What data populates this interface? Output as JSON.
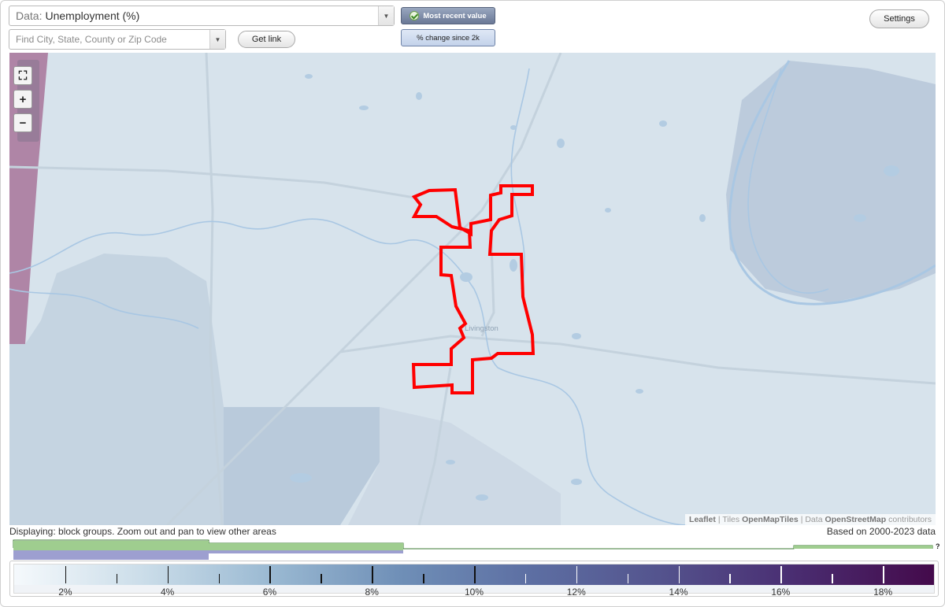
{
  "controls": {
    "data_label": "Data:",
    "data_value": "Unemployment (%)",
    "search_placeholder": "Find City, State, County or Zip Code",
    "get_link": "Get link",
    "most_recent": "Most recent value",
    "pct_change": "% change since 2k",
    "settings": "Settings"
  },
  "map": {
    "town_label": "Livingston",
    "attribution": {
      "leaflet": "Leaflet",
      "tiles_prefix": "| Tiles",
      "tiles": "OpenMapTiles",
      "data_prefix": "| Data",
      "data": "OpenStreetMap",
      "contributors": "contributors"
    },
    "highlight_color": "#ff0000",
    "water_color": "#a9c7e3",
    "road_color": "#c7d4de"
  },
  "footer": {
    "displaying": "Displaying: block groups. Zoom out and pan to view other areas",
    "based_on": "Based on 2000-2023 data",
    "question": "?"
  },
  "legend": {
    "labels": [
      "2%",
      "4%",
      "6%",
      "8%",
      "10%",
      "12%",
      "14%",
      "16%",
      "18%"
    ],
    "min": 1,
    "max": 19
  }
}
